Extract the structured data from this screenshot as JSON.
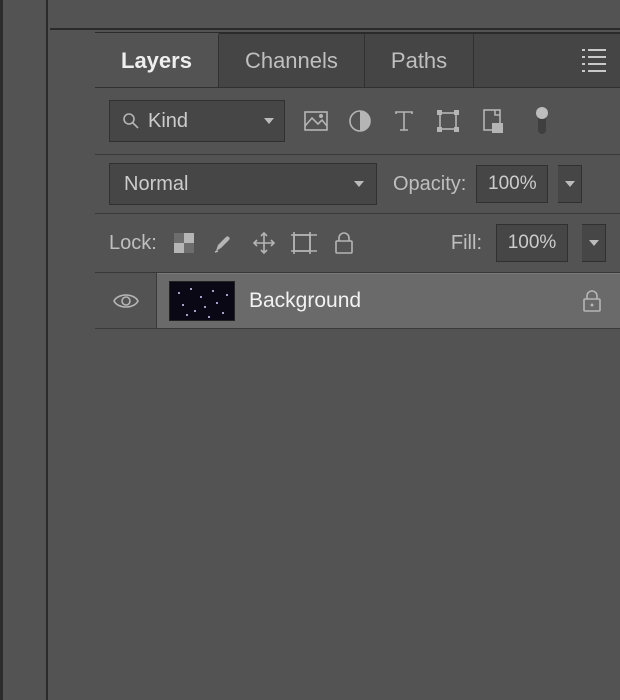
{
  "tabs": {
    "layers": "Layers",
    "channels": "Channels",
    "paths": "Paths"
  },
  "filter": {
    "kind_label": "Kind"
  },
  "blend": {
    "mode": "Normal",
    "opacity_label": "Opacity:",
    "opacity_value": "100%"
  },
  "lock": {
    "label": "Lock:",
    "fill_label": "Fill:",
    "fill_value": "100%"
  },
  "layer": {
    "name": "Background"
  }
}
